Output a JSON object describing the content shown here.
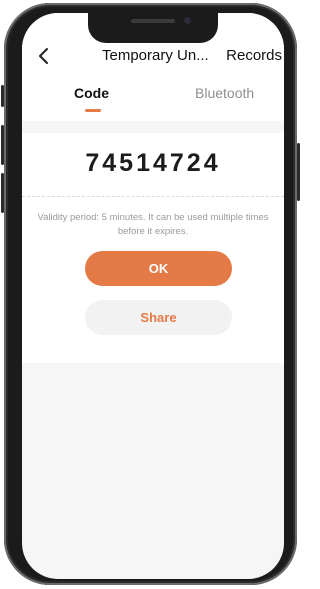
{
  "header": {
    "back_icon": "chevron-left-icon",
    "title": "Temporary Un...",
    "records_label": "Records"
  },
  "tabs": [
    {
      "label": "Code",
      "active": true
    },
    {
      "label": "Bluetooth",
      "active": false
    }
  ],
  "code": {
    "value": "74514724",
    "validity_line1": "Validity period: 5 minutes. It can be used multiple times",
    "validity_line2": "before it expires."
  },
  "actions": {
    "ok_label": "OK",
    "share_label": "Share"
  },
  "colors": {
    "accent": "#e47a46",
    "background": "#f6f6f6",
    "secondary_button": "#f2f2f2"
  }
}
